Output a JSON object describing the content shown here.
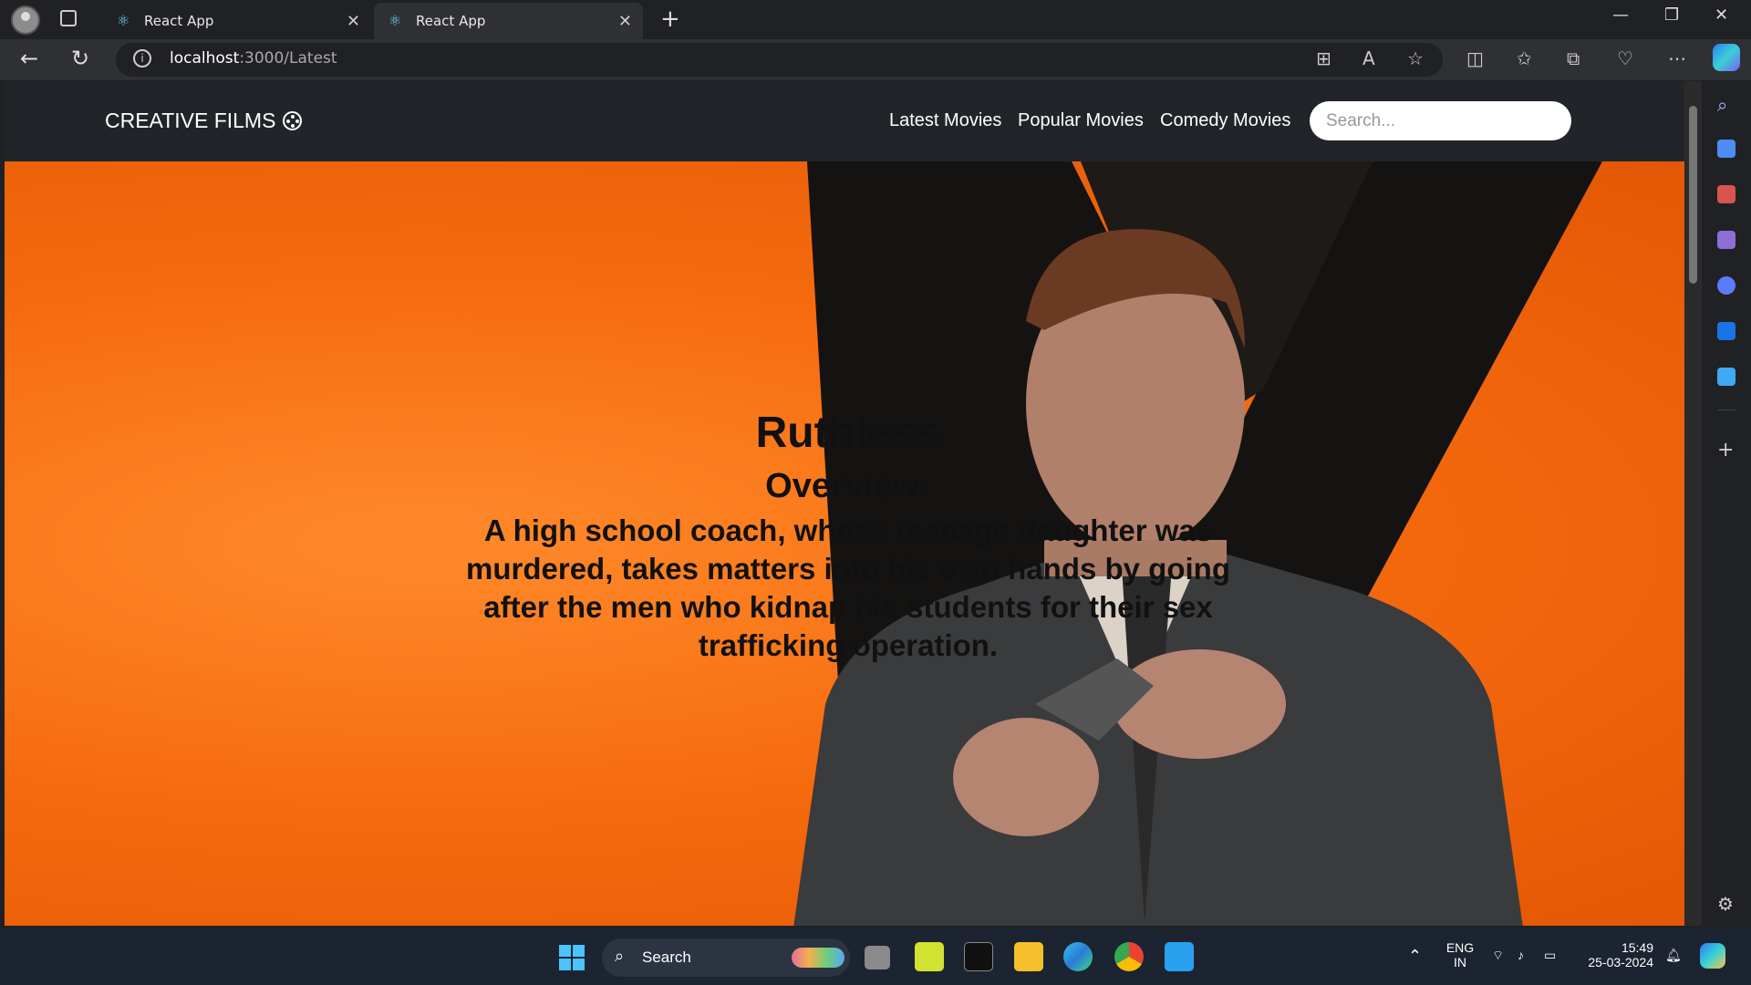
{
  "browser": {
    "tabs": [
      {
        "label": "React App",
        "active": false
      },
      {
        "label": "React App",
        "active": true
      }
    ],
    "url_host": "localhost",
    "url_path": ":3000/Latest"
  },
  "navbar": {
    "brand": "CREATIVE FILMS",
    "links": [
      "Latest Movies",
      "Popular Movies",
      "Comedy Movies"
    ],
    "search_placeholder": "Search..."
  },
  "hero": {
    "title": "Ruthless",
    "overview_label": "Overview:",
    "overview": "A high school coach, whose teenage daughter was murdered, takes matters into his own hands by going after the men who kidnap his students for their sex trafficking operation."
  },
  "taskbar": {
    "search_label": "Search",
    "lang_line1": "ENG",
    "lang_line2": "IN",
    "time": "15:49",
    "date": "25-03-2024"
  },
  "colors": {
    "hero_orange": "#f66a0e",
    "navbar_bg": "#212529"
  }
}
